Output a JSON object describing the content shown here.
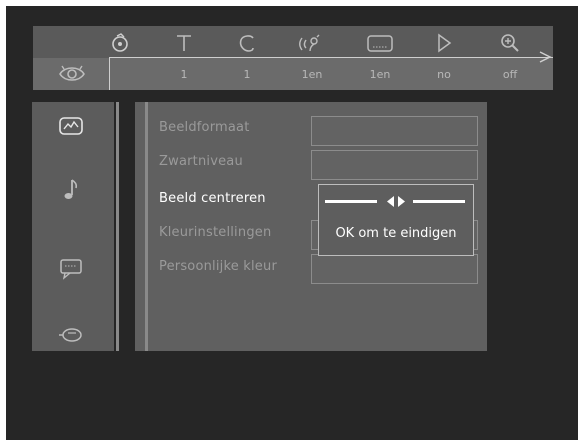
{
  "topbar": {
    "icons": [
      "disc-audio-icon",
      "title-icon",
      "chapter-icon",
      "audio-language-icon",
      "subtitle-icon",
      "play-mode-icon",
      "zoom-icon"
    ],
    "values": [
      "1",
      "1",
      "1en",
      "1en",
      "no",
      "off"
    ],
    "row_icon": "eye-settings-icon"
  },
  "sidebar": {
    "items": [
      {
        "icon": "picture-settings-icon",
        "selected": true
      },
      {
        "icon": "sound-settings-icon",
        "selected": false
      },
      {
        "icon": "language-settings-icon",
        "selected": false
      },
      {
        "icon": "features-settings-icon",
        "selected": false
      }
    ]
  },
  "menu": {
    "items": [
      {
        "label": "Beeldformaat",
        "active": false
      },
      {
        "label": "Zwartniveau",
        "active": false
      },
      {
        "label": "Beeld centreren",
        "active": true
      },
      {
        "label": "Kleurinstellingen",
        "active": false
      },
      {
        "label": "Persoonlijke kleur",
        "active": false
      }
    ]
  },
  "popup": {
    "message": "OK om te eindigen",
    "slider_icon": "left-right-arrows-icon"
  }
}
